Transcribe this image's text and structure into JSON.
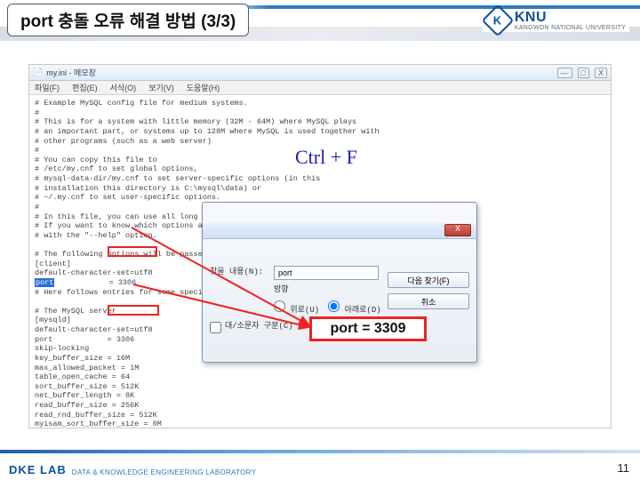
{
  "header": {
    "title": "port 충돌 오류 해결 방법 (3/3)",
    "logo_big": "KNU",
    "logo_small": "KANGWON NATIONAL UNIVERSITY",
    "logo_mark": "K"
  },
  "app": {
    "window_title": "my.ini - 메모장",
    "menu": [
      "파일(F)",
      "편집(E)",
      "서식(O)",
      "보기(V)",
      "도움말(H)"
    ],
    "win_min": "—",
    "win_max": "□",
    "win_close": "X"
  },
  "editor": {
    "block1": "# Example MySQL config file for medium systems.\n#\n# This is for a system with little memory (32M - 64M) where MySQL plays\n# an important part, or systems up to 128M where MySQL is used together with\n# other programs (such as a web server)\n#\n# You can copy this file to\n# /etc/my.cnf to set global options,\n# mysql-data-dir/my.cnf to set server-specific options (in this\n# installation this directory is C:\\mysql\\data) or\n# ~/.my.cnf to set user-specific options.\n#\n# In this file, you can use all long options that a program supports.\n# If you want to know which options a program supports, run the program\n# with the \"--help\" option.\n\n# The following options will be passed to all MySQL clients\n[client]\ndefault-character-set=utf8",
    "hl": "port",
    "after_hl": "            = 3306",
    "block2": "\n# Here follows entries for some specific programs\n\n# The MySQL server\n[mysqld]\ndefault-character-set=utf8\nport            = 3306\nskip-locking\nkey_buffer_size = 16M\nmax_allowed_packet = 1M\ntable_open_cache = 64\nsort_buffer_size = 512K\nnet_buffer_length = 8K\nread_buffer_size = 256K\nread_rnd_buffer_size = 512K\nmyisam_sort_buffer_size = 8M\nskip-innodb\n\n# Don't listen on a TCP/IP port at all. This can be a security enhancement,"
  },
  "find": {
    "label_what": "찾을 내용(N):",
    "input_value": "port",
    "direction_title": "방향",
    "dir_up": "위로(U)",
    "dir_down": "아래로(D)",
    "case_label": "대/소문자 구분(C)",
    "btn_find": "다음 찾기(F)",
    "btn_cancel": "취소",
    "close_x": "X"
  },
  "annot": {
    "ctrlF": "Ctrl + F",
    "port_eq": "port = 3309"
  },
  "footer": {
    "lab1": "DKE LAB",
    "lab2": "DATA & KNOWLEDGE ENGINEERING LABORATORY",
    "page": "11"
  }
}
